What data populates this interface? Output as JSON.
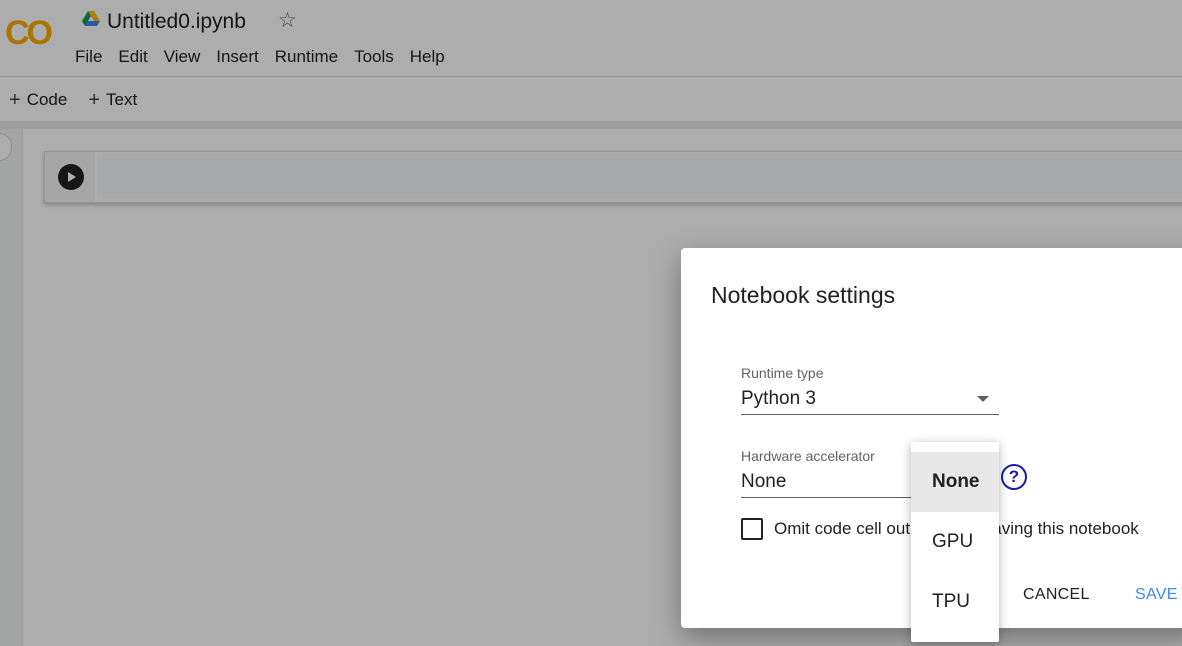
{
  "app": {
    "logo_text": "CO",
    "doc_title": "Untitled0.ipynb",
    "star_icon": "star-outline-icon",
    "drive_icon": "google-drive-icon",
    "menu": [
      "File",
      "Edit",
      "View",
      "Insert",
      "Runtime",
      "Tools",
      "Help"
    ]
  },
  "toolbar": {
    "add_code_label": "Code",
    "add_text_label": "Text",
    "plus_glyph": "+"
  },
  "dialog": {
    "title": "Notebook settings",
    "runtime_type": {
      "label": "Runtime type",
      "value": "Python 3"
    },
    "hardware_accelerator": {
      "label": "Hardware accelerator",
      "value": "None"
    },
    "help_glyph": "?",
    "omit_label": "Omit code cell output when saving this notebook",
    "omit_checked": false,
    "cancel_label": "CANCEL",
    "save_label": "SAVE"
  },
  "accelerator_menu": {
    "options": [
      "None",
      "GPU",
      "TPU"
    ],
    "selected": "None"
  },
  "colors": {
    "accent_blue": "#4285f4",
    "logo_orange": "#f9ab00",
    "help_icon": "#1a1aae"
  }
}
